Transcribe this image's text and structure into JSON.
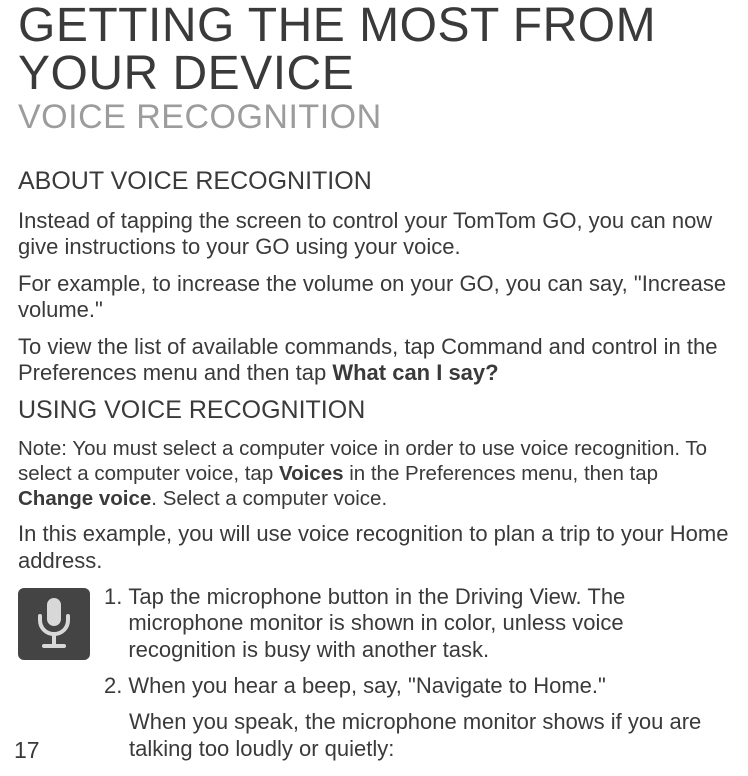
{
  "title": "GETTING THE MOST FROM YOUR DEVICE",
  "subtitle": "VOICE RECOGNITION",
  "section1": {
    "heading": "ABOUT VOICE RECOGNITION",
    "p1": "Instead of tapping the screen to control your TomTom GO, you can now give instructions to your GO using your voice.",
    "p2": "For example, to increase the volume on your GO, you can say, \"Increase volume.\"",
    "p3_pre": "To view the list of available commands, tap Command and control in the Preferences menu and then tap ",
    "p3_bold": "What can I say?"
  },
  "section2": {
    "heading": "USING VOICE RECOGNITION",
    "note_pre": "Note: You must select a computer voice in order to use voice recognition. To select a computer voice, tap ",
    "note_bold1": "Voices",
    "note_mid": " in the Preferences menu, then tap ",
    "note_bold2": "Change voice",
    "note_post": ". Select a computer voice.",
    "intro": "In this example, you will use voice recognition to plan a trip to your Home address.",
    "items": [
      {
        "marker": "1.",
        "text": "Tap the microphone button in the Driving View. The microphone monitor is shown in color, unless voice recognition is busy with another task."
      },
      {
        "marker": "2.",
        "text": "When you hear a beep, say, \"Navigate to Home.\""
      }
    ],
    "sub": "When you speak, the microphone monitor shows if you are talking too loudly or quietly:"
  },
  "pageNumber": "17"
}
